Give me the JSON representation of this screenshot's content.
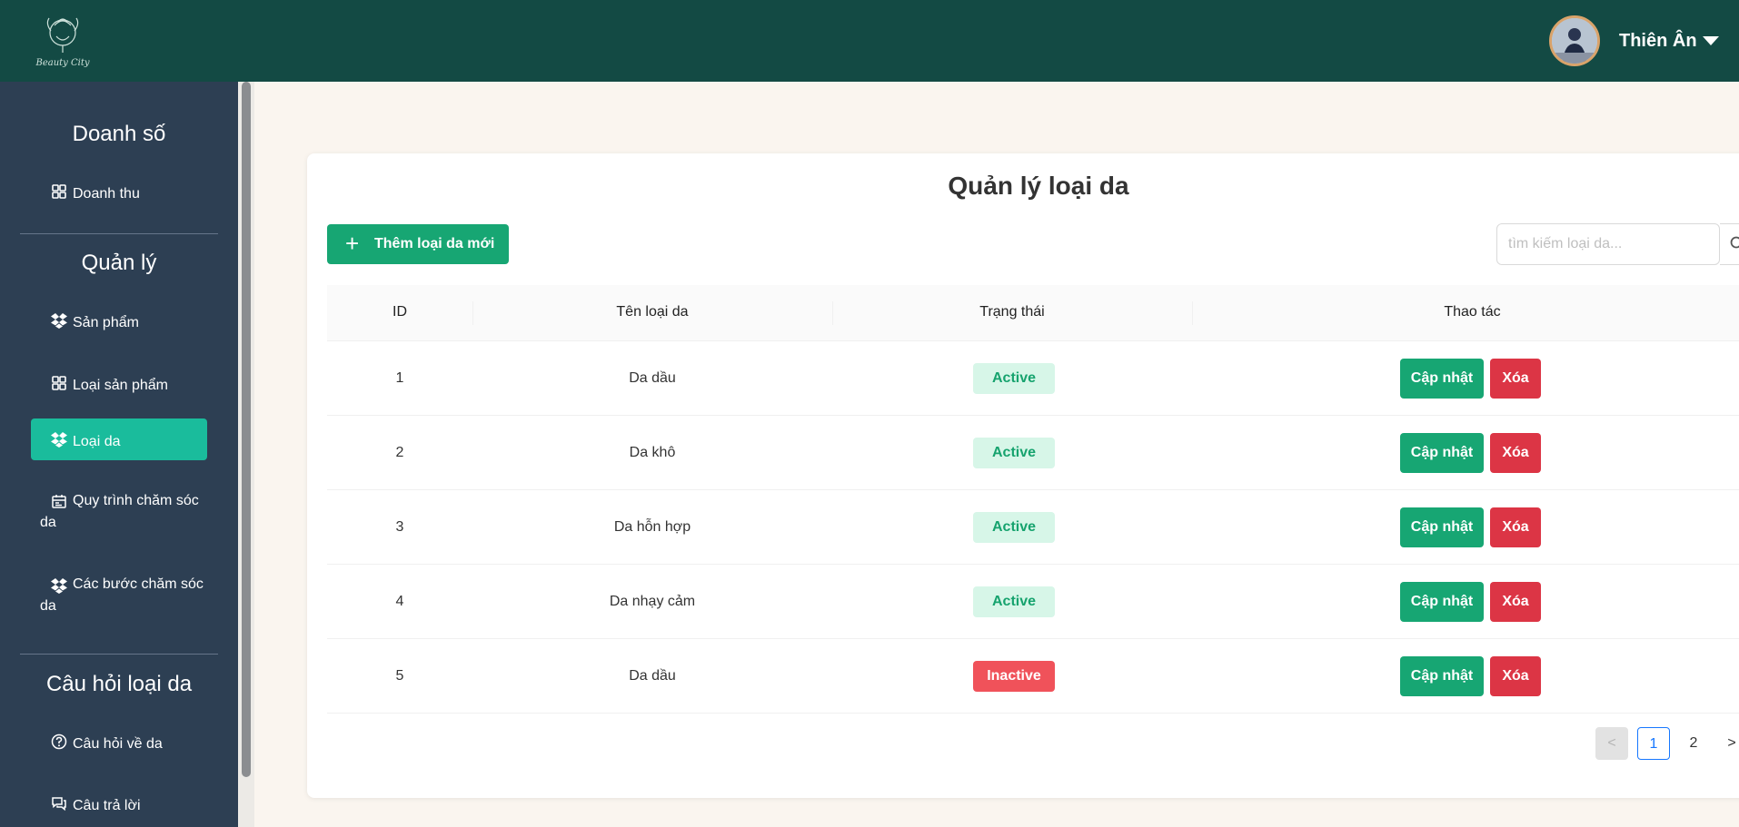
{
  "header": {
    "logo_text": "Beauty City",
    "user_name": "Thiên Ân"
  },
  "sidebar": {
    "sections": [
      {
        "heading": "Doanh số",
        "items": [
          {
            "label": "Doanh thu",
            "icon": "grid-icon"
          }
        ]
      },
      {
        "heading": "Quản lý",
        "items": [
          {
            "label": "Sản phẩm",
            "icon": "dropbox-icon"
          },
          {
            "label": "Loại sản phẩm",
            "icon": "grid-icon"
          },
          {
            "label": "Loại da",
            "icon": "dropbox-icon",
            "active": true
          },
          {
            "label": "Quy trình chăm sóc da",
            "icon": "calendar-icon"
          },
          {
            "label": "Các bước chăm sóc da",
            "icon": "dropbox-icon"
          }
        ]
      },
      {
        "heading": "Câu hỏi loại da",
        "items": [
          {
            "label": "Câu hỏi về da",
            "icon": "question-circle-icon"
          },
          {
            "label": "Câu trả lời",
            "icon": "chat-icon"
          }
        ]
      }
    ]
  },
  "main": {
    "title": "Quản lý loại da",
    "add_button": "Thêm loại da mới",
    "search_placeholder": "tìm kiếm loại da...",
    "columns": [
      "ID",
      "Tên loại da",
      "Trạng thái",
      "Thao tác"
    ],
    "rows": [
      {
        "id": "1",
        "name": "Da dầu",
        "status": "Active",
        "status_type": "active"
      },
      {
        "id": "2",
        "name": "Da khô",
        "status": "Active",
        "status_type": "active"
      },
      {
        "id": "3",
        "name": "Da hỗn hợp",
        "status": "Active",
        "status_type": "active"
      },
      {
        "id": "4",
        "name": "Da nhạy cảm",
        "status": "Active",
        "status_type": "active"
      },
      {
        "id": "5",
        "name": "Da dầu",
        "status": "Inactive",
        "status_type": "inactive"
      }
    ],
    "update_label": "Cập nhật",
    "delete_label": "Xóa",
    "pagination": {
      "prev": "<",
      "pages": [
        "1",
        "2"
      ],
      "current": "1",
      "next": ">"
    }
  },
  "colors": {
    "header_bg": "#134a44",
    "sidebar_bg": "#2d3f53",
    "active_item": "#1abc9c",
    "primary_button": "#17a673",
    "danger_button": "#dc3545"
  }
}
